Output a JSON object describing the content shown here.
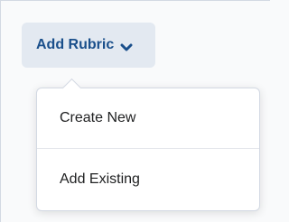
{
  "button": {
    "label": "Add Rubric",
    "icon": "chevron-down-icon",
    "text_color": "#1a4f8b",
    "background": "#e3e9f1"
  },
  "menu": {
    "items": [
      {
        "label": "Create New"
      },
      {
        "label": "Add Existing"
      }
    ]
  }
}
